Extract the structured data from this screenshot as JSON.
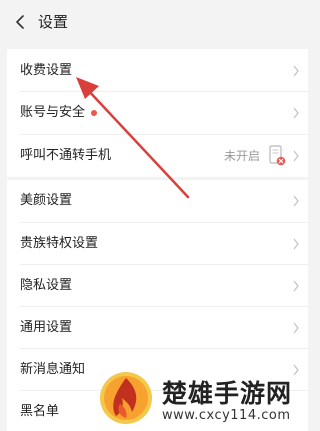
{
  "header": {
    "back_icon": "chevron-left-icon",
    "title": "设置"
  },
  "groups": [
    {
      "rows": [
        {
          "label": "收费设置"
        },
        {
          "label": "账号与安全",
          "badge": "red-dot"
        },
        {
          "label": "呼叫不通转手机",
          "status": "未开启",
          "icon": "call-forward-disabled-icon"
        }
      ]
    },
    {
      "rows": [
        {
          "label": "美颜设置"
        },
        {
          "label": "贵族特权设置"
        },
        {
          "label": "隐私设置"
        },
        {
          "label": "通用设置"
        },
        {
          "label": "新消息通知"
        },
        {
          "label": "黑名单"
        }
      ]
    }
  ],
  "annotation": {
    "type": "red-arrow",
    "target": "收费设置"
  },
  "watermark": {
    "logo_icon": "flame-logo-icon",
    "text": "楚雄手游网",
    "url": "www.cxcy114.com"
  },
  "colors": {
    "background": "#f3f3f3",
    "card": "#ffffff",
    "accent_red": "#e85a4f",
    "arrow_red": "#d9403c",
    "muted_text": "#9a9a9a"
  }
}
